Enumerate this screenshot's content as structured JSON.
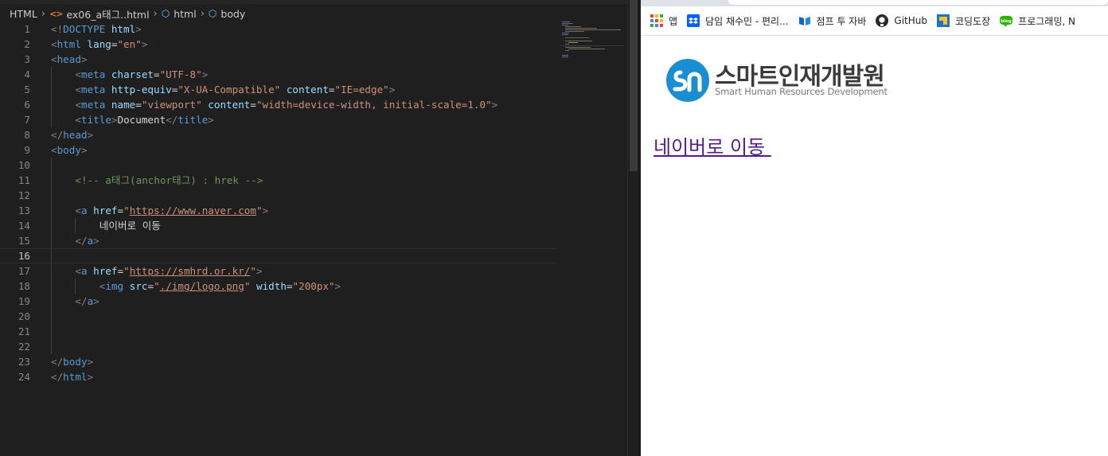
{
  "breadcrumb": {
    "root": "HTML",
    "file": "ex06_a태그..html",
    "html": "html",
    "body": "body"
  },
  "code": {
    "lines": [
      {
        "n": "1",
        "tokens": [
          [
            "b",
            "<!"
          ],
          [
            "t",
            "DOCTYPE"
          ],
          [
            "p",
            " "
          ],
          [
            "a",
            "html"
          ],
          [
            "b",
            ">"
          ]
        ]
      },
      {
        "n": "2",
        "tokens": [
          [
            "b",
            "<"
          ],
          [
            "t",
            "html"
          ],
          [
            "p",
            " "
          ],
          [
            "a",
            "lang"
          ],
          [
            "p",
            "="
          ],
          [
            "s",
            "\"en\""
          ],
          [
            "b",
            ">"
          ]
        ]
      },
      {
        "n": "3",
        "tokens": [
          [
            "b",
            "<"
          ],
          [
            "t",
            "head"
          ],
          [
            "b",
            ">"
          ]
        ]
      },
      {
        "n": "4",
        "indent": 1,
        "tokens": [
          [
            "b",
            "<"
          ],
          [
            "t",
            "meta"
          ],
          [
            "p",
            " "
          ],
          [
            "a",
            "charset"
          ],
          [
            "p",
            "="
          ],
          [
            "s",
            "\"UTF-8\""
          ],
          [
            "b",
            ">"
          ]
        ]
      },
      {
        "n": "5",
        "indent": 1,
        "tokens": [
          [
            "b",
            "<"
          ],
          [
            "t",
            "meta"
          ],
          [
            "p",
            " "
          ],
          [
            "a",
            "http-equiv"
          ],
          [
            "p",
            "="
          ],
          [
            "s",
            "\"X-UA-Compatible\""
          ],
          [
            "p",
            " "
          ],
          [
            "a",
            "content"
          ],
          [
            "p",
            "="
          ],
          [
            "s",
            "\"IE=edge\""
          ],
          [
            "b",
            ">"
          ]
        ]
      },
      {
        "n": "6",
        "indent": 1,
        "tokens": [
          [
            "b",
            "<"
          ],
          [
            "t",
            "meta"
          ],
          [
            "p",
            " "
          ],
          [
            "a",
            "name"
          ],
          [
            "p",
            "="
          ],
          [
            "s",
            "\"viewport\""
          ],
          [
            "p",
            " "
          ],
          [
            "a",
            "content"
          ],
          [
            "p",
            "="
          ],
          [
            "s",
            "\"width=device-width, initial-scale=1.0\""
          ],
          [
            "b",
            ">"
          ]
        ]
      },
      {
        "n": "7",
        "indent": 1,
        "tokens": [
          [
            "b",
            "<"
          ],
          [
            "t",
            "title"
          ],
          [
            "b",
            ">"
          ],
          [
            "p",
            "Document"
          ],
          [
            "b",
            "</"
          ],
          [
            "t",
            "title"
          ],
          [
            "b",
            ">"
          ]
        ]
      },
      {
        "n": "8",
        "tokens": [
          [
            "b",
            "</"
          ],
          [
            "t",
            "head"
          ],
          [
            "b",
            ">"
          ]
        ]
      },
      {
        "n": "9",
        "tokens": [
          [
            "b",
            "<"
          ],
          [
            "t",
            "body"
          ],
          [
            "b",
            ">"
          ]
        ]
      },
      {
        "n": "10",
        "indent": 0,
        "guides": 1,
        "tokens": []
      },
      {
        "n": "11",
        "indent": 1,
        "tokens": [
          [
            "c",
            "<!-- a태그(anchor태그) : hrek -->"
          ]
        ]
      },
      {
        "n": "12",
        "guides": 1,
        "tokens": []
      },
      {
        "n": "13",
        "indent": 1,
        "tokens": [
          [
            "b",
            "<"
          ],
          [
            "t",
            "a"
          ],
          [
            "p",
            " "
          ],
          [
            "a",
            "href"
          ],
          [
            "p",
            "="
          ],
          [
            "s",
            "\""
          ],
          [
            "su",
            "https://www.naver.com"
          ],
          [
            "s",
            "\""
          ],
          [
            "b",
            ">"
          ]
        ]
      },
      {
        "n": "14",
        "indent": 2,
        "tokens": [
          [
            "p",
            "네이버로 이동"
          ]
        ]
      },
      {
        "n": "15",
        "indent": 1,
        "tokens": [
          [
            "b",
            "</"
          ],
          [
            "t",
            "a"
          ],
          [
            "b",
            ">"
          ]
        ]
      },
      {
        "n": "16",
        "current": true,
        "guides": 1,
        "tokens": []
      },
      {
        "n": "17",
        "indent": 1,
        "tokens": [
          [
            "b",
            "<"
          ],
          [
            "t",
            "a"
          ],
          [
            "p",
            " "
          ],
          [
            "a",
            "href"
          ],
          [
            "p",
            "="
          ],
          [
            "s",
            "\""
          ],
          [
            "su",
            "https://smhrd.or.kr/"
          ],
          [
            "s",
            "\""
          ],
          [
            "b",
            ">"
          ]
        ]
      },
      {
        "n": "18",
        "indent": 2,
        "tokens": [
          [
            "b",
            "<"
          ],
          [
            "t",
            "img"
          ],
          [
            "p",
            " "
          ],
          [
            "a",
            "src"
          ],
          [
            "p",
            "="
          ],
          [
            "s",
            "\""
          ],
          [
            "su",
            "./img/logo.png"
          ],
          [
            "s",
            "\""
          ],
          [
            "p",
            " "
          ],
          [
            "a",
            "width"
          ],
          [
            "p",
            "="
          ],
          [
            "s",
            "\"200px\""
          ],
          [
            "b",
            ">"
          ]
        ]
      },
      {
        "n": "19",
        "indent": 1,
        "tokens": [
          [
            "b",
            "</"
          ],
          [
            "t",
            "a"
          ],
          [
            "b",
            ">"
          ]
        ]
      },
      {
        "n": "20",
        "guides": 1,
        "tokens": []
      },
      {
        "n": "21",
        "guides": 1,
        "tokens": []
      },
      {
        "n": "22",
        "guides": 1,
        "tokens": []
      },
      {
        "n": "23",
        "tokens": [
          [
            "b",
            "</"
          ],
          [
            "t",
            "body"
          ],
          [
            "b",
            ">"
          ]
        ]
      },
      {
        "n": "24",
        "tokens": [
          [
            "b",
            "</"
          ],
          [
            "t",
            "html"
          ],
          [
            "b",
            ">"
          ]
        ]
      }
    ]
  },
  "bookmarks": [
    {
      "label": "앱",
      "icon": "apps-icon"
    },
    {
      "label": "담임 채수민 - 편리...",
      "icon": "dropbox-icon"
    },
    {
      "label": "점프 투 자바",
      "icon": "wikidocs-icon"
    },
    {
      "label": "GitHub",
      "icon": "github-icon"
    },
    {
      "label": "코딩도장",
      "icon": "codingdojang-icon"
    },
    {
      "label": "프로그래밍, N",
      "icon": "naver-blog-icon"
    }
  ],
  "page": {
    "logo_ko": "스마트인재개발원",
    "logo_en": "Smart Human Resources Development",
    "link_text": "네이버로 이동 "
  },
  "colors": {
    "editor_bg": "#1f1f1f",
    "tag": "#569cd6",
    "attr": "#9cdcfe",
    "string": "#ce9178",
    "comment": "#6a9955",
    "link_visited": "#551a8b",
    "logo_blue": "#1a8ed3"
  }
}
